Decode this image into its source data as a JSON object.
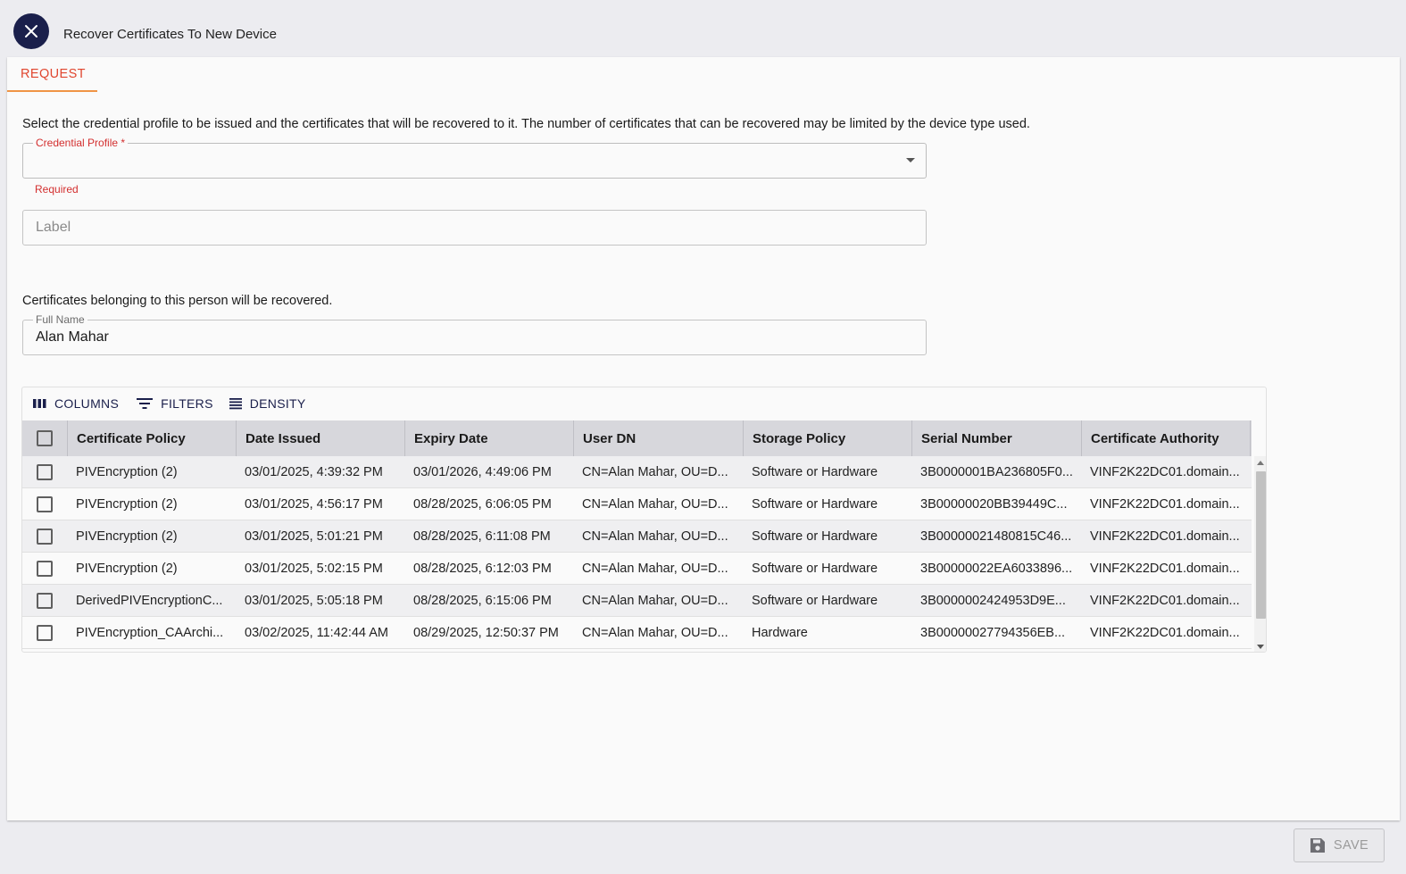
{
  "header": {
    "title": "Recover Certificates To New Device"
  },
  "tabs": [
    {
      "label": "REQUEST"
    }
  ],
  "instructions": "Select the credential profile to be issued and the certificates that will be recovered to it. The number of certificates that can be recovered may be limited by the device type used.",
  "credential_profile": {
    "label": "Credential Profile *",
    "value": "",
    "helper": "Required"
  },
  "label_field": {
    "placeholder": "Label",
    "value": ""
  },
  "recovery_text": "Certificates belonging to this person will be recovered.",
  "full_name": {
    "label": "Full Name",
    "value": "Alan Mahar"
  },
  "toolbar": {
    "columns": "COLUMNS",
    "filters": "FILTERS",
    "density": "DENSITY"
  },
  "grid": {
    "columns": [
      "Certificate Policy",
      "Date Issued",
      "Expiry Date",
      "User DN",
      "Storage Policy",
      "Serial Number",
      "Certificate Authority"
    ],
    "rows": [
      [
        "PIVEncryption (2)",
        "03/01/2025, 4:39:32 PM",
        "03/01/2026, 4:49:06 PM",
        "CN=Alan Mahar, OU=D...",
        "Software or Hardware",
        "3B0000001BA236805F0...",
        "VINF2K22DC01.domain..."
      ],
      [
        "PIVEncryption (2)",
        "03/01/2025, 4:56:17 PM",
        "08/28/2025, 6:06:05 PM",
        "CN=Alan Mahar, OU=D...",
        "Software or Hardware",
        "3B00000020BB39449C...",
        "VINF2K22DC01.domain..."
      ],
      [
        "PIVEncryption (2)",
        "03/01/2025, 5:01:21 PM",
        "08/28/2025, 6:11:08 PM",
        "CN=Alan Mahar, OU=D...",
        "Software or Hardware",
        "3B00000021480815C46...",
        "VINF2K22DC01.domain..."
      ],
      [
        "PIVEncryption (2)",
        "03/01/2025, 5:02:15 PM",
        "08/28/2025, 6:12:03 PM",
        "CN=Alan Mahar, OU=D...",
        "Software or Hardware",
        "3B00000022EA6033896...",
        "VINF2K22DC01.domain..."
      ],
      [
        "DerivedPIVEncryptionC...",
        "03/01/2025, 5:05:18 PM",
        "08/28/2025, 6:15:06 PM",
        "CN=Alan Mahar, OU=D...",
        "Software or Hardware",
        "3B0000002424953D9E...",
        "VINF2K22DC01.domain..."
      ],
      [
        "PIVEncryption_CAArchi...",
        "03/02/2025, 11:42:44 AM",
        "08/29/2025, 12:50:37 PM",
        "CN=Alan Mahar, OU=D...",
        "Hardware",
        "3B00000027794356EB...",
        "VINF2K22DC01.domain..."
      ]
    ]
  },
  "footer": {
    "save_label": "SAVE"
  },
  "colors": {
    "accent": "#e0462f",
    "tab_underline": "#f09445",
    "navy": "#1a1f4b",
    "error": "#d32f2f"
  },
  "icons": {
    "close": "close-icon",
    "columns": "columns-icon",
    "filters": "filter-icon",
    "density": "density-icon",
    "save": "floppy-disk-icon",
    "dropdown": "arrow-drop-down-icon"
  }
}
